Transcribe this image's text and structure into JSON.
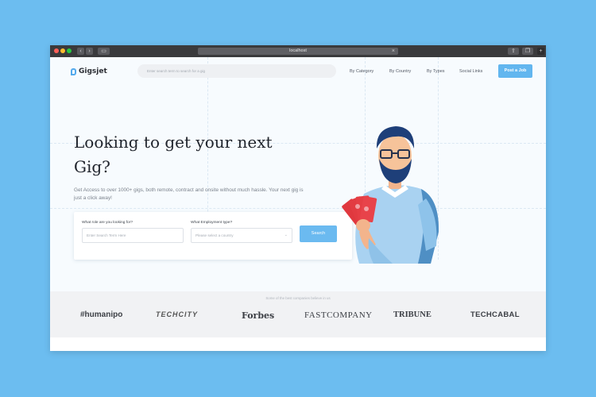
{
  "browser": {
    "url": "localhost"
  },
  "nav": {
    "logo_text": "Gigsjet",
    "search_placeholder": "Enter search term to search for a gig",
    "links": [
      "By Category",
      "By Country",
      "By Types",
      "Social Links"
    ],
    "post_job": "Post a Job"
  },
  "hero": {
    "title_line1": "Looking to get your next",
    "title_line2": "Gig?",
    "subtitle": "Get Access to over 1000+ gigs, both remote, contract and onsite without much hassle. Your next gig is just a click away!"
  },
  "search_card": {
    "role_label": "What role are you looking for?",
    "role_placeholder": "Enter Search Term Here",
    "type_label": "What Employment type?",
    "type_placeholder": "Please select a country",
    "search_button": "Search"
  },
  "companies": {
    "caption": "Some of the best companies believe in us",
    "logos": [
      "#humanipo",
      "TECHCITY",
      "Forbes",
      "FASTCOMPANY",
      "TRIBUNE",
      "TECHCABAL"
    ]
  },
  "colors": {
    "accent": "#62b6ef",
    "background": "#6cbdf0"
  }
}
